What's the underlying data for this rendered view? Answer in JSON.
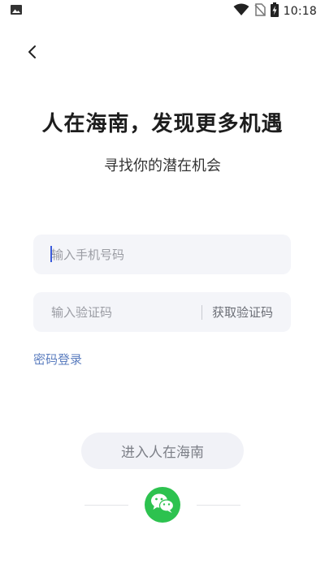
{
  "status_bar": {
    "time": "10:18",
    "icons": [
      "image-notification-icon",
      "wifi-icon",
      "no-sim-icon",
      "battery-charging-icon"
    ]
  },
  "header": {
    "back_icon": "chevron-left-icon"
  },
  "main": {
    "title": "人在海南，发现更多机遇",
    "subtitle": "寻找你的潜在机会"
  },
  "form": {
    "phone_placeholder": "输入手机号码",
    "code_placeholder": "输入验证码",
    "get_code_label": "获取验证码",
    "password_login_label": "密码登录",
    "submit_label": "进入人在海南"
  },
  "third_party": {
    "wechat_icon": "wechat-icon"
  },
  "colors": {
    "field_bg": "#f4f5f9",
    "link": "#5b7dbf",
    "wechat": "#2dc24f"
  }
}
